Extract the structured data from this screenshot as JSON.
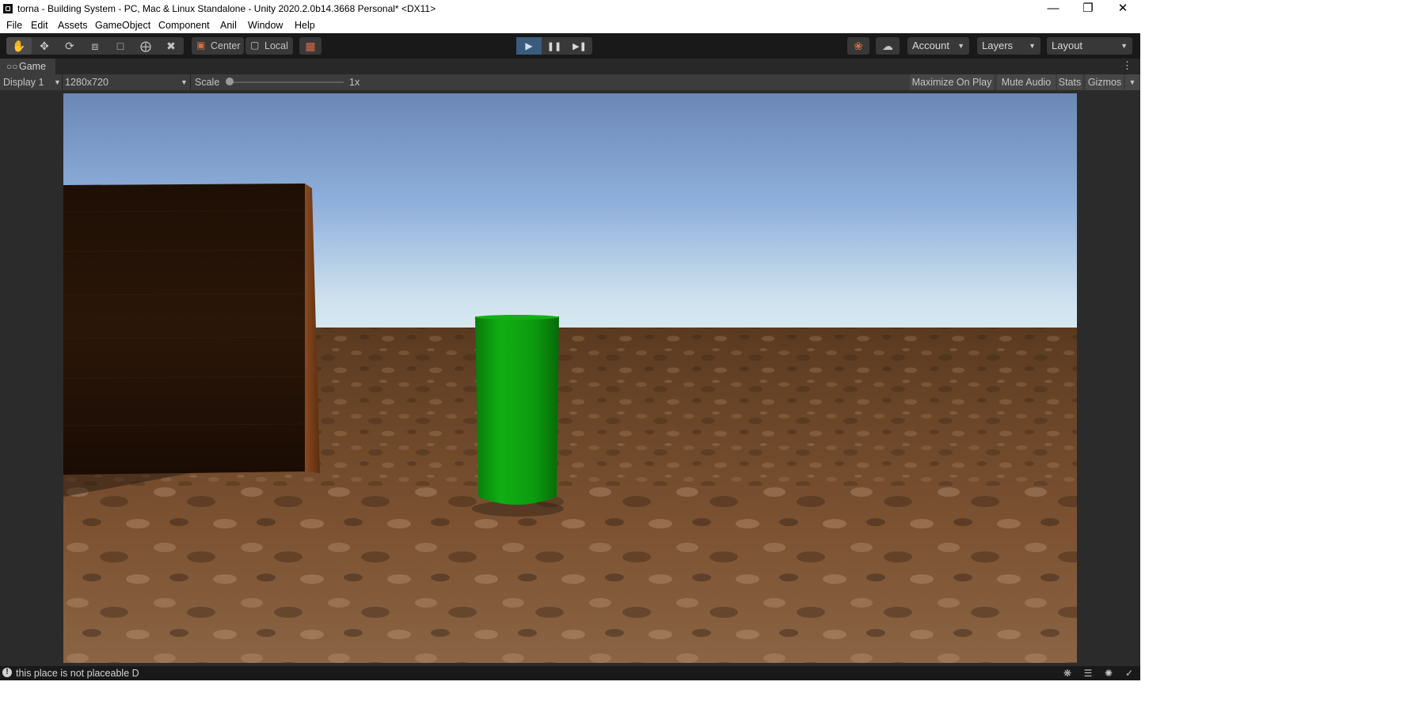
{
  "window": {
    "title": "torna - Building System - PC, Mac & Linux Standalone - Unity 2020.2.0b14.3668 Personal* <DX11>",
    "app_icon": "unity-logo-icon",
    "controls": [
      "minimize-icon",
      "restore-icon",
      "close-icon"
    ]
  },
  "menu": {
    "items": [
      "File",
      "Edit",
      "Assets",
      "GameObject",
      "Component",
      "Anil",
      "Window",
      "Help"
    ]
  },
  "toolbar": {
    "tools": [
      "hand-icon",
      "move-icon",
      "rotate-icon",
      "scale-icon",
      "rect-icon",
      "transform-icon",
      "custom-tool-icon"
    ],
    "active_tool": "hand-icon",
    "pivot_mode": "Center",
    "pivot_rotation": "Local",
    "grid_snap_icon": "grid-snap-icon",
    "play_state": "playing",
    "collab_icon": "collab-icon",
    "cloud_icon": "cloud-icon",
    "account": "Account",
    "layers": "Layers",
    "layout": "Layout"
  },
  "game_view": {
    "tab_label": "Game",
    "display": "Display 1",
    "resolution": "1280x720",
    "scale_label": "Scale",
    "scale_value": "1x",
    "maximize_on_play": "Maximize On Play",
    "mute_audio": "Mute Audio",
    "stats": "Stats",
    "gizmos": "Gizmos"
  },
  "colors": {
    "sky_top": "#6b87b5",
    "sky_horizon": "#dbeaf0",
    "ground": "#7a5030",
    "cylinder": "#0d9a0f",
    "wall": "#2a1608",
    "play_active": "#3a5b7c"
  },
  "status": {
    "message": "this place is not placeable D",
    "icons": [
      "bug-icon",
      "stack-icon",
      "progress-icon",
      "check-icon"
    ]
  }
}
